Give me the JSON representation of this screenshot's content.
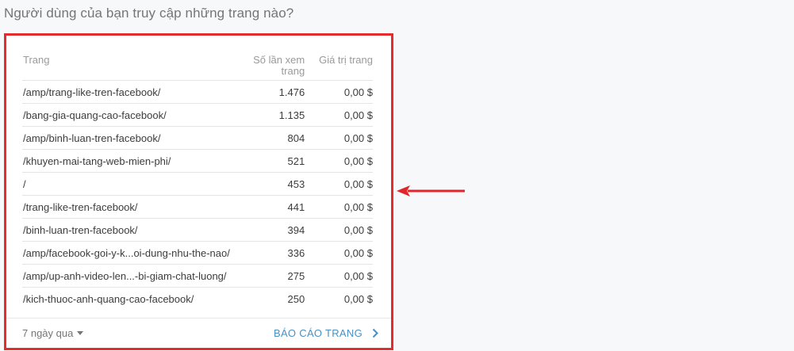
{
  "header": {
    "question": "Người dùng của bạn truy cập những trang nào?"
  },
  "table": {
    "columns": {
      "page": "Trang",
      "views": "Số lần xem trang",
      "value": "Giá trị trang"
    },
    "rows": [
      {
        "page": "/amp/trang-like-tren-facebook/",
        "views": "1.476",
        "value": "0,00 $"
      },
      {
        "page": "/bang-gia-quang-cao-facebook/",
        "views": "1.135",
        "value": "0,00 $"
      },
      {
        "page": "/amp/binh-luan-tren-facebook/",
        "views": "804",
        "value": "0,00 $"
      },
      {
        "page": "/khuyen-mai-tang-web-mien-phi/",
        "views": "521",
        "value": "0,00 $"
      },
      {
        "page": "/",
        "views": "453",
        "value": "0,00 $"
      },
      {
        "page": "/trang-like-tren-facebook/",
        "views": "441",
        "value": "0,00 $"
      },
      {
        "page": "/binh-luan-tren-facebook/",
        "views": "394",
        "value": "0,00 $"
      },
      {
        "page": "/amp/facebook-goi-y-k...oi-dung-nhu-the-nao/",
        "views": "336",
        "value": "0,00 $"
      },
      {
        "page": "/amp/up-anh-video-len...-bi-giam-chat-luong/",
        "views": "275",
        "value": "0,00 $"
      },
      {
        "page": "/kich-thuoc-anh-quang-cao-facebook/",
        "views": "250",
        "value": "0,00 $"
      }
    ]
  },
  "footer": {
    "date_range": "7 ngày qua",
    "report_link": "BÁO CÁO TRANG"
  },
  "icons": {
    "dropdown": "caret-down-icon",
    "report": "chevron-right-icon",
    "annotation": "arrow-left-icon"
  },
  "colors": {
    "highlight_border": "#e52b2b",
    "link": "#4a90c2",
    "annotation_arrow": "#e0262a"
  }
}
